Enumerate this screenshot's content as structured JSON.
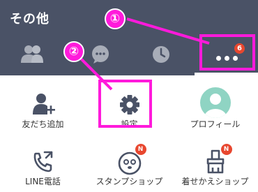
{
  "header": {
    "title": "その他",
    "tabs": [
      {
        "icon": "friends-icon"
      },
      {
        "icon": "chat-icon"
      },
      {
        "icon": "timeline-icon"
      },
      {
        "icon": "more-icon",
        "badge": "6",
        "selected": true
      }
    ]
  },
  "grid": {
    "row1": [
      {
        "label": "友だち追加",
        "icon": "add-friend-icon"
      },
      {
        "label": "設定",
        "icon": "gear-icon"
      },
      {
        "label": "プロフィール",
        "icon": "profile-avatar-icon"
      }
    ],
    "row2": [
      {
        "label": "LINE電話",
        "icon": "line-call-icon"
      },
      {
        "label": "スタンプショップ",
        "icon": "sticker-shop-icon",
        "badge": "N"
      },
      {
        "label": "着せかえショップ",
        "icon": "theme-shop-icon",
        "badge": "N"
      }
    ]
  },
  "annotations": {
    "marker1": "①",
    "marker2": "②"
  },
  "colors": {
    "header_bg": "#4a5266",
    "annotation": "#ff1adb",
    "badge": "#e8472f",
    "avatar": "#8fd4c3"
  }
}
